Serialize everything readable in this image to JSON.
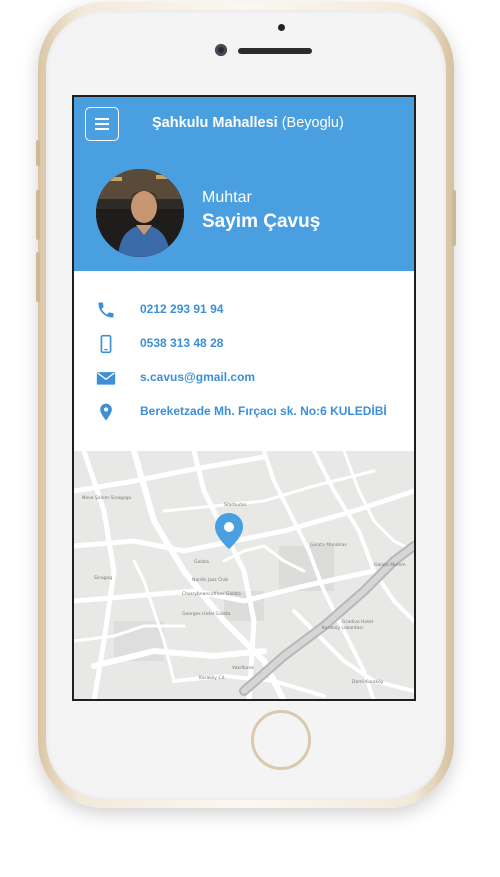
{
  "header": {
    "neighborhood": "Şahkulu Mahallesi",
    "district": "(Beyoglu)",
    "role": "Muhtar",
    "name": "Sayim Çavuş"
  },
  "contacts": [
    {
      "type": "phone-icon",
      "value": "0212 293 91 94"
    },
    {
      "type": "mobile-icon",
      "value": "0538 313 48 28"
    },
    {
      "type": "email-icon",
      "value": "s.cavus@gmail.com"
    },
    {
      "type": "location-icon",
      "value": "Bereketzade Mh. Fırçacı sk. No:6 KULEDİBİ"
    }
  ],
  "map": {
    "labels": [
      "Neve Şalom Sinagogu",
      "Sinagog",
      "Nardis Jazz Club",
      "Galata",
      "Cherrybeancoffees Galata",
      "Konak Cafe",
      "Georges Hotel Galata",
      "Galata Mandıras",
      "Galata Mumm",
      "Kemeraltı Cd.",
      "Starbucks",
      "Karaköy Lokantası",
      "Demi Karaköy",
      "Gradiva Hotel",
      "Vakıfbank",
      "Karaköy Cd.",
      "Okçu Musa Cd.",
      "Kart Çınar Sk.",
      "Bankalar Cd.",
      "Perşembe Pazarı Cd.",
      "Necatibey Cd.",
      "Felek Sk.",
      "Lüleci Hendek Cd.",
      "Yüksek Kaldırım",
      "Serdar-ı Ekrem",
      "Şair Ziya Paşa Cd.",
      "Mueyyet Sk.",
      "Kumbaracı Yk.",
      "Hoca Ali Sk.",
      "Bereketzade Sk."
    ]
  },
  "colors": {
    "accent": "#4a9fe0",
    "link": "#3d8fd6"
  }
}
